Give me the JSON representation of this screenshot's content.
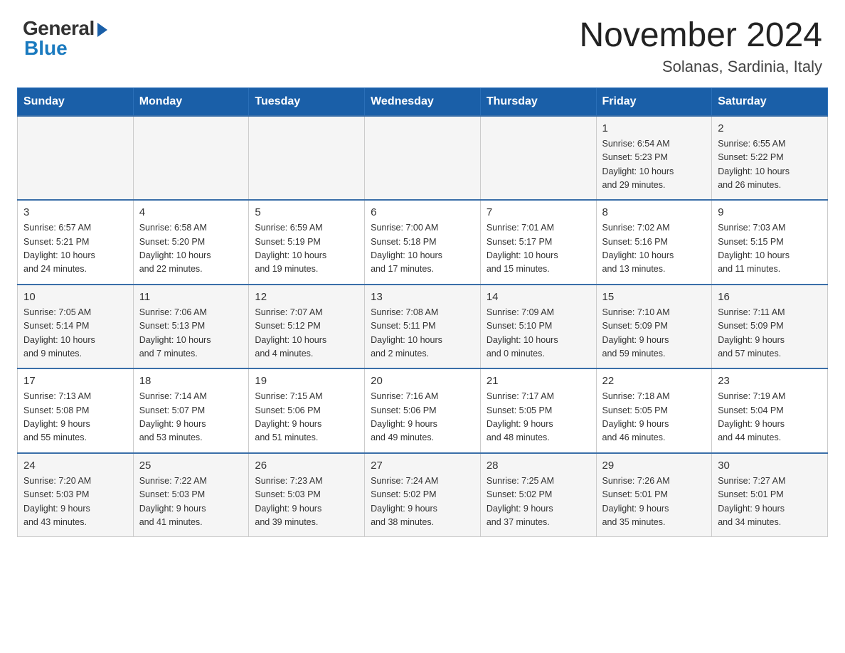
{
  "header": {
    "logo_general": "General",
    "logo_blue": "Blue",
    "month_year": "November 2024",
    "location": "Solanas, Sardinia, Italy"
  },
  "weekdays": [
    "Sunday",
    "Monday",
    "Tuesday",
    "Wednesday",
    "Thursday",
    "Friday",
    "Saturday"
  ],
  "weeks": [
    [
      {
        "day": "",
        "info": ""
      },
      {
        "day": "",
        "info": ""
      },
      {
        "day": "",
        "info": ""
      },
      {
        "day": "",
        "info": ""
      },
      {
        "day": "",
        "info": ""
      },
      {
        "day": "1",
        "info": "Sunrise: 6:54 AM\nSunset: 5:23 PM\nDaylight: 10 hours\nand 29 minutes."
      },
      {
        "day": "2",
        "info": "Sunrise: 6:55 AM\nSunset: 5:22 PM\nDaylight: 10 hours\nand 26 minutes."
      }
    ],
    [
      {
        "day": "3",
        "info": "Sunrise: 6:57 AM\nSunset: 5:21 PM\nDaylight: 10 hours\nand 24 minutes."
      },
      {
        "day": "4",
        "info": "Sunrise: 6:58 AM\nSunset: 5:20 PM\nDaylight: 10 hours\nand 22 minutes."
      },
      {
        "day": "5",
        "info": "Sunrise: 6:59 AM\nSunset: 5:19 PM\nDaylight: 10 hours\nand 19 minutes."
      },
      {
        "day": "6",
        "info": "Sunrise: 7:00 AM\nSunset: 5:18 PM\nDaylight: 10 hours\nand 17 minutes."
      },
      {
        "day": "7",
        "info": "Sunrise: 7:01 AM\nSunset: 5:17 PM\nDaylight: 10 hours\nand 15 minutes."
      },
      {
        "day": "8",
        "info": "Sunrise: 7:02 AM\nSunset: 5:16 PM\nDaylight: 10 hours\nand 13 minutes."
      },
      {
        "day": "9",
        "info": "Sunrise: 7:03 AM\nSunset: 5:15 PM\nDaylight: 10 hours\nand 11 minutes."
      }
    ],
    [
      {
        "day": "10",
        "info": "Sunrise: 7:05 AM\nSunset: 5:14 PM\nDaylight: 10 hours\nand 9 minutes."
      },
      {
        "day": "11",
        "info": "Sunrise: 7:06 AM\nSunset: 5:13 PM\nDaylight: 10 hours\nand 7 minutes."
      },
      {
        "day": "12",
        "info": "Sunrise: 7:07 AM\nSunset: 5:12 PM\nDaylight: 10 hours\nand 4 minutes."
      },
      {
        "day": "13",
        "info": "Sunrise: 7:08 AM\nSunset: 5:11 PM\nDaylight: 10 hours\nand 2 minutes."
      },
      {
        "day": "14",
        "info": "Sunrise: 7:09 AM\nSunset: 5:10 PM\nDaylight: 10 hours\nand 0 minutes."
      },
      {
        "day": "15",
        "info": "Sunrise: 7:10 AM\nSunset: 5:09 PM\nDaylight: 9 hours\nand 59 minutes."
      },
      {
        "day": "16",
        "info": "Sunrise: 7:11 AM\nSunset: 5:09 PM\nDaylight: 9 hours\nand 57 minutes."
      }
    ],
    [
      {
        "day": "17",
        "info": "Sunrise: 7:13 AM\nSunset: 5:08 PM\nDaylight: 9 hours\nand 55 minutes."
      },
      {
        "day": "18",
        "info": "Sunrise: 7:14 AM\nSunset: 5:07 PM\nDaylight: 9 hours\nand 53 minutes."
      },
      {
        "day": "19",
        "info": "Sunrise: 7:15 AM\nSunset: 5:06 PM\nDaylight: 9 hours\nand 51 minutes."
      },
      {
        "day": "20",
        "info": "Sunrise: 7:16 AM\nSunset: 5:06 PM\nDaylight: 9 hours\nand 49 minutes."
      },
      {
        "day": "21",
        "info": "Sunrise: 7:17 AM\nSunset: 5:05 PM\nDaylight: 9 hours\nand 48 minutes."
      },
      {
        "day": "22",
        "info": "Sunrise: 7:18 AM\nSunset: 5:05 PM\nDaylight: 9 hours\nand 46 minutes."
      },
      {
        "day": "23",
        "info": "Sunrise: 7:19 AM\nSunset: 5:04 PM\nDaylight: 9 hours\nand 44 minutes."
      }
    ],
    [
      {
        "day": "24",
        "info": "Sunrise: 7:20 AM\nSunset: 5:03 PM\nDaylight: 9 hours\nand 43 minutes."
      },
      {
        "day": "25",
        "info": "Sunrise: 7:22 AM\nSunset: 5:03 PM\nDaylight: 9 hours\nand 41 minutes."
      },
      {
        "day": "26",
        "info": "Sunrise: 7:23 AM\nSunset: 5:03 PM\nDaylight: 9 hours\nand 39 minutes."
      },
      {
        "day": "27",
        "info": "Sunrise: 7:24 AM\nSunset: 5:02 PM\nDaylight: 9 hours\nand 38 minutes."
      },
      {
        "day": "28",
        "info": "Sunrise: 7:25 AM\nSunset: 5:02 PM\nDaylight: 9 hours\nand 37 minutes."
      },
      {
        "day": "29",
        "info": "Sunrise: 7:26 AM\nSunset: 5:01 PM\nDaylight: 9 hours\nand 35 minutes."
      },
      {
        "day": "30",
        "info": "Sunrise: 7:27 AM\nSunset: 5:01 PM\nDaylight: 9 hours\nand 34 minutes."
      }
    ]
  ]
}
